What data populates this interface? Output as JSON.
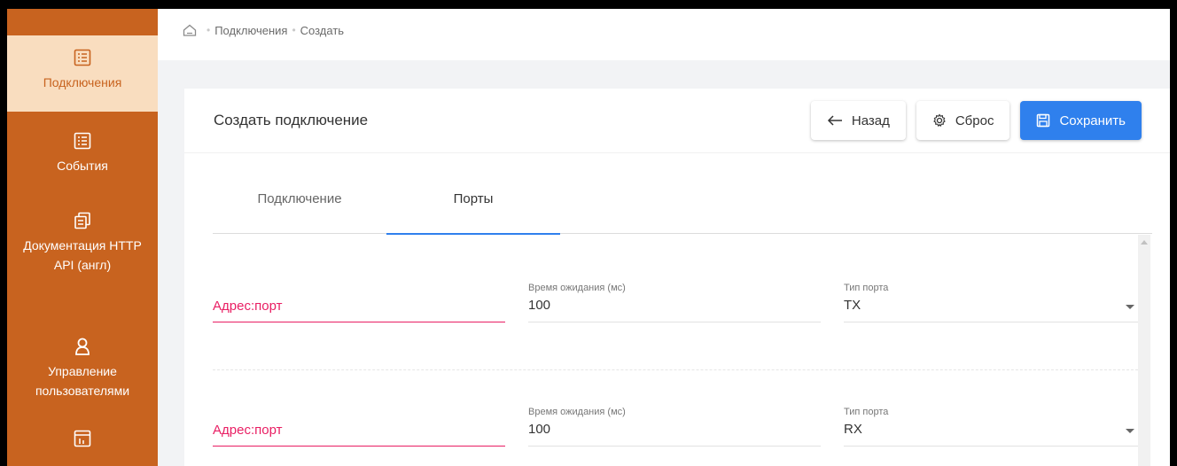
{
  "sidebar": {
    "items": [
      {
        "label": "Подключения",
        "icon": "list-icon",
        "active": true
      },
      {
        "label": "События",
        "icon": "list-icon",
        "active": false
      },
      {
        "label": "Документация HTTP API (англ)",
        "icon": "documents-icon",
        "active": false
      },
      {
        "label": "Управление пользователями",
        "icon": "user-icon",
        "active": false
      },
      {
        "label": "",
        "icon": "dashboard-icon",
        "active": false
      }
    ]
  },
  "breadcrumb": {
    "home_icon": "home-icon",
    "items": [
      "Подключения",
      "Создать"
    ]
  },
  "card": {
    "title": "Создать подключение",
    "back_label": "Назад",
    "reset_label": "Сброс",
    "save_label": "Сохранить"
  },
  "tabs": [
    "Подключение",
    "Порты"
  ],
  "active_tab": "Порты",
  "ports": [
    {
      "address_placeholder": "Адрес:порт",
      "timeout_label": "Время ожидания (мс)",
      "timeout_value": "100",
      "type_label": "Тип порта",
      "type_value": "TX"
    },
    {
      "address_placeholder": "Адрес:порт",
      "timeout_label": "Время ожидания (мс)",
      "timeout_value": "100",
      "type_label": "Тип порта",
      "type_value": "RX"
    }
  ],
  "colors": {
    "sidebar_bg": "#c8631f",
    "sidebar_active_bg": "#f9ddbf",
    "primary": "#2f80ed",
    "error": "#e91e63"
  }
}
